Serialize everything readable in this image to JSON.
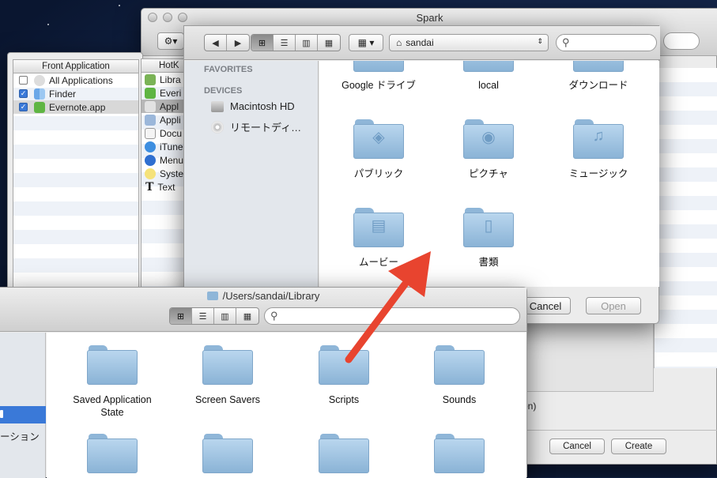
{
  "spark": {
    "title": "Spark",
    "cancel": "Cancel",
    "create": "Create",
    "partial_label": "ction)"
  },
  "front_panel": {
    "header": "Front Application",
    "rows": [
      {
        "label": "All Applications",
        "checked": false
      },
      {
        "label": "Finder",
        "checked": true
      },
      {
        "label": "Evernote.app",
        "checked": true
      }
    ]
  },
  "hotkey_panel": {
    "header": "HotK",
    "items": [
      "Libra",
      "Everi",
      "Appl",
      "Appli",
      "Docu",
      "iTune",
      "Menu",
      "Syste",
      "Text"
    ]
  },
  "open_dialog": {
    "location": "sandai",
    "search_placeholder": "",
    "sidebar": {
      "favorites_header": "FAVORITES",
      "devices_header": "DEVICES",
      "devices": [
        "Macintosh HD",
        "リモートディ…"
      ]
    },
    "folders_top": [
      "Google ドライブ",
      "local",
      "ダウンロード"
    ],
    "folders": [
      {
        "label": "パブリック",
        "icon": "public-icon"
      },
      {
        "label": "ピクチャ",
        "icon": "camera-icon"
      },
      {
        "label": "ミュージック",
        "icon": "music-note-icon"
      },
      {
        "label": "ムービー",
        "icon": "film-icon"
      },
      {
        "label": "書類",
        "icon": "document-icon"
      }
    ],
    "cancel": "Cancel",
    "open": "Open"
  },
  "library_window": {
    "path": "/Users/sandai/Library",
    "search_placeholder": "",
    "sidebar_partial": "ーション",
    "folders": [
      "Saved Application State",
      "Screen Savers",
      "Scripts",
      "Sounds"
    ]
  },
  "colors": {
    "arrow": "#e8442f",
    "selection": "#3a79d8"
  }
}
